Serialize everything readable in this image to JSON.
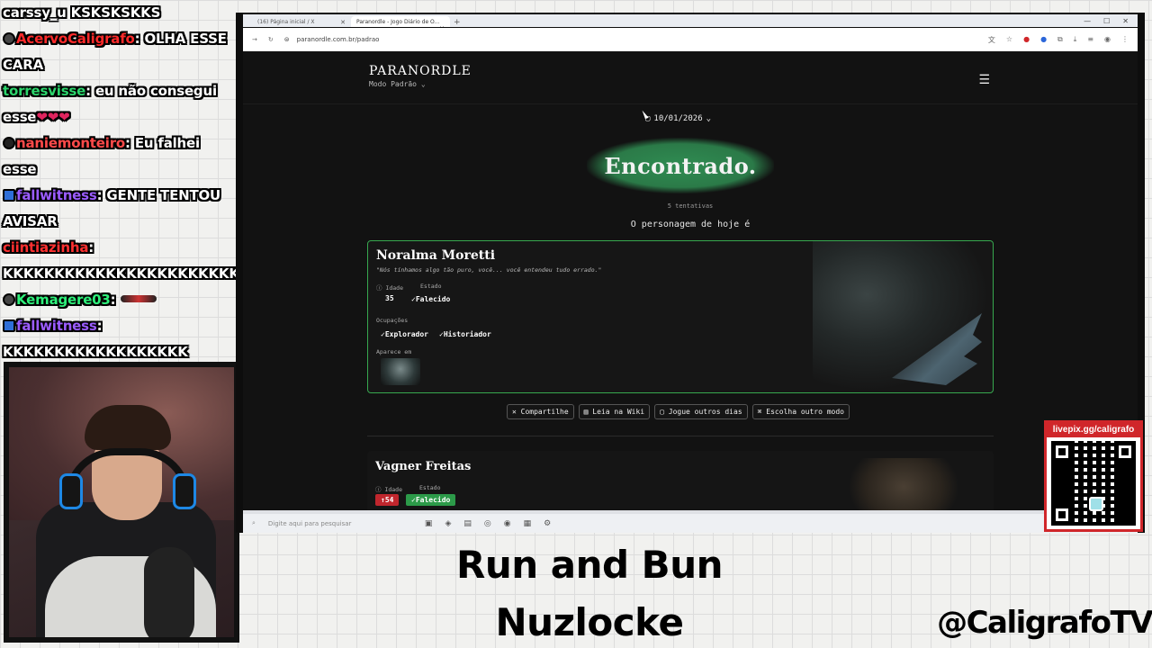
{
  "chat": [
    {
      "user": "carssy_u",
      "user_color": "#ffffff",
      "badges": [],
      "message": " KSKSKSKKS"
    },
    {
      "user": "AcervoCaligrafo",
      "user_color": "#ff2a2a",
      "badges": [
        "bot"
      ],
      "message": ": OLHA ESSE CARA"
    },
    {
      "user": "torresvisse",
      "user_color": "#2bd46b",
      "badges": [],
      "message": ": eu não consegui esse"
    },
    {
      "user": "naniemonteiro",
      "user_color": "#ff4a4a",
      "badges": [
        "mod"
      ],
      "message": ": Eu falhei esse"
    },
    {
      "user": "fallwitness",
      "user_color": "#9b5cff",
      "badges": [
        "sub"
      ],
      "message": ": GENTE TENTOU AVISAR"
    },
    {
      "user": "ciintiazinha",
      "user_color": "#ff3030",
      "badges": [],
      "message": ": KKKKKKKKKKKKKKKKKKKKKKKK"
    },
    {
      "user": "Kemagere03",
      "user_color": "#2ef07a",
      "badges": [
        "skull"
      ],
      "message": ":"
    },
    {
      "user": "fallwitness",
      "user_color": "#9b5cff",
      "badges": [
        "sub"
      ],
      "message": ": KKKKKKKKKKKKKKKKKK"
    }
  ],
  "browser": {
    "tabs": [
      {
        "label": "(16) Página inicial / X",
        "active": false
      },
      {
        "label": "Paranordle - Jogo Diário de O...",
        "active": true
      }
    ],
    "url": "paranordle.com.br/padrao"
  },
  "site": {
    "logo": "PARANORDLE",
    "mode": "Modo Padrão",
    "date": "10/01/2026",
    "banner": "Encontrado.",
    "attempts": "5 tentativas",
    "today_label": "O personagem de hoje é"
  },
  "character": {
    "name": "Noralma Moretti",
    "quote": "\"Nós tínhamos algo tão puro, você... você entendeu tudo errado.\"",
    "age_label": "Idade",
    "age": "35",
    "state_label": "Estado",
    "state": "Falecido",
    "occupations_label": "Ocupações",
    "occupations": [
      "Explorador",
      "Historiador"
    ],
    "appears_label": "Aparece em"
  },
  "actions": [
    {
      "icon": "x-icon",
      "label": "Compartilhe"
    },
    {
      "icon": "book-icon",
      "label": "Leia na Wiki"
    },
    {
      "icon": "calendar-icon",
      "label": "Jogue outros dias"
    },
    {
      "icon": "gamepad-icon",
      "label": "Escolha outro modo"
    }
  ],
  "guess2": {
    "name": "Vagner Freitas",
    "age_label": "Idade",
    "age": "54",
    "state_label": "Estado",
    "state": "Falecido"
  },
  "taskbar": {
    "search_placeholder": "Digite aqui para pesquisar"
  },
  "overlay": {
    "qr_label": "livepix.gg/caligrafo",
    "title_line1": "Run and Bun",
    "title_line2": "Nuzlocke",
    "handle": "@CaligrafoTV"
  },
  "colors": {
    "accent_green": "#37a84f",
    "error_red": "#c0262d",
    "livepix_red": "#d0262a"
  }
}
